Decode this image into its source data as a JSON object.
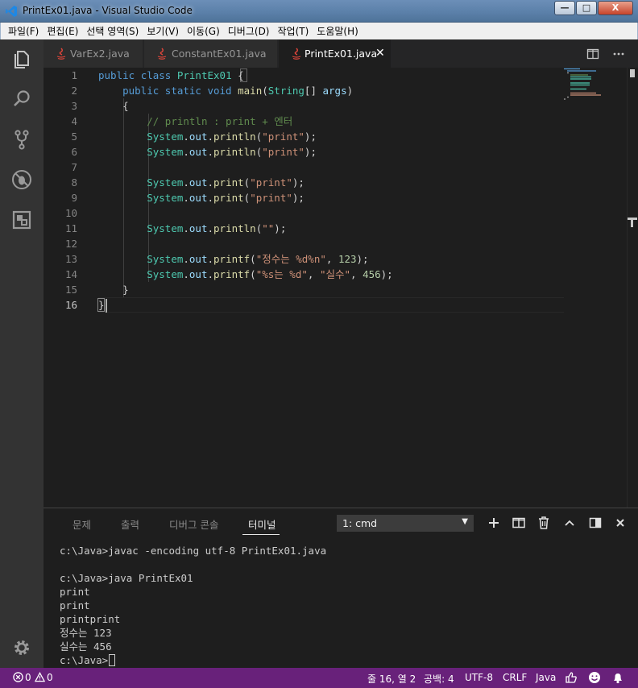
{
  "window": {
    "title": "PrintEx01.java - Visual Studio Code",
    "controls": {
      "minimize": "—",
      "maximize": "□",
      "close": "X"
    }
  },
  "menu": [
    "파일(F)",
    "편집(E)",
    "선택 영역(S)",
    "보기(V)",
    "이동(G)",
    "디버그(D)",
    "작업(T)",
    "도움말(H)"
  ],
  "activity_bar": [
    "explorer-icon",
    "search-icon",
    "source-control-icon",
    "debug-icon",
    "extensions-icon",
    "settings-gear-icon"
  ],
  "tabs": [
    {
      "label": "VarEx2.java",
      "active": false
    },
    {
      "label": "ConstantEx01.java",
      "active": false
    },
    {
      "label": "PrintEx01.java",
      "active": true,
      "close": "✕"
    }
  ],
  "editor": {
    "line_numbers": [
      "1",
      "2",
      "3",
      "4",
      "5",
      "6",
      "7",
      "8",
      "9",
      "10",
      "11",
      "12",
      "13",
      "14",
      "15",
      "16"
    ],
    "current_line": "16",
    "lines": [
      [
        [
          "kw",
          "public"
        ],
        [
          "pl",
          " "
        ],
        [
          "kw",
          "class"
        ],
        [
          "pl",
          " "
        ],
        [
          "ty",
          "PrintEx01"
        ],
        [
          "pl",
          " {"
        ]
      ],
      [
        [
          "pl",
          "    "
        ],
        [
          "kw",
          "public"
        ],
        [
          "pl",
          " "
        ],
        [
          "kw",
          "static"
        ],
        [
          "pl",
          " "
        ],
        [
          "kw",
          "void"
        ],
        [
          "pl",
          " "
        ],
        [
          "fn",
          "main"
        ],
        [
          "pl",
          "("
        ],
        [
          "ty",
          "String"
        ],
        [
          "pl",
          "[] "
        ],
        [
          "id",
          "args"
        ],
        [
          "pl",
          ")"
        ]
      ],
      [
        [
          "pl",
          "    {"
        ]
      ],
      [
        [
          "pl",
          "        "
        ],
        [
          "cm",
          "// println : print + 엔터"
        ]
      ],
      [
        [
          "pl",
          "        "
        ],
        [
          "ty",
          "System"
        ],
        [
          "pl",
          "."
        ],
        [
          "id",
          "out"
        ],
        [
          "pl",
          "."
        ],
        [
          "fn",
          "println"
        ],
        [
          "pl",
          "("
        ],
        [
          "st",
          "\"print\""
        ],
        [
          "pl",
          ");"
        ]
      ],
      [
        [
          "pl",
          "        "
        ],
        [
          "ty",
          "System"
        ],
        [
          "pl",
          "."
        ],
        [
          "id",
          "out"
        ],
        [
          "pl",
          "."
        ],
        [
          "fn",
          "println"
        ],
        [
          "pl",
          "("
        ],
        [
          "st",
          "\"print\""
        ],
        [
          "pl",
          ");"
        ]
      ],
      [],
      [
        [
          "pl",
          "        "
        ],
        [
          "ty",
          "System"
        ],
        [
          "pl",
          "."
        ],
        [
          "id",
          "out"
        ],
        [
          "pl",
          "."
        ],
        [
          "fn",
          "print"
        ],
        [
          "pl",
          "("
        ],
        [
          "st",
          "\"print\""
        ],
        [
          "pl",
          ");"
        ]
      ],
      [
        [
          "pl",
          "        "
        ],
        [
          "ty",
          "System"
        ],
        [
          "pl",
          "."
        ],
        [
          "id",
          "out"
        ],
        [
          "pl",
          "."
        ],
        [
          "fn",
          "print"
        ],
        [
          "pl",
          "("
        ],
        [
          "st",
          "\"print\""
        ],
        [
          "pl",
          ");"
        ]
      ],
      [],
      [
        [
          "pl",
          "        "
        ],
        [
          "ty",
          "System"
        ],
        [
          "pl",
          "."
        ],
        [
          "id",
          "out"
        ],
        [
          "pl",
          "."
        ],
        [
          "fn",
          "println"
        ],
        [
          "pl",
          "("
        ],
        [
          "st",
          "\"\""
        ],
        [
          "pl",
          ");"
        ]
      ],
      [],
      [
        [
          "pl",
          "        "
        ],
        [
          "ty",
          "System"
        ],
        [
          "pl",
          "."
        ],
        [
          "id",
          "out"
        ],
        [
          "pl",
          "."
        ],
        [
          "fn",
          "printf"
        ],
        [
          "pl",
          "("
        ],
        [
          "st",
          "\"정수는 %d%n\""
        ],
        [
          "pl",
          ", "
        ],
        [
          "nu",
          "123"
        ],
        [
          "pl",
          ");"
        ]
      ],
      [
        [
          "pl",
          "        "
        ],
        [
          "ty",
          "System"
        ],
        [
          "pl",
          "."
        ],
        [
          "id",
          "out"
        ],
        [
          "pl",
          "."
        ],
        [
          "fn",
          "printf"
        ],
        [
          "pl",
          "("
        ],
        [
          "st",
          "\"%s는 %d\""
        ],
        [
          "pl",
          ", "
        ],
        [
          "st",
          "\"실수\""
        ],
        [
          "pl",
          ", "
        ],
        [
          "nu",
          "456"
        ],
        [
          "pl",
          ");"
        ]
      ],
      [
        [
          "pl",
          "    }"
        ]
      ],
      [
        [
          "pl",
          "}"
        ]
      ]
    ]
  },
  "panel": {
    "tabs": [
      {
        "label": "문제",
        "active": false
      },
      {
        "label": "출력",
        "active": false
      },
      {
        "label": "디버그 콘솔",
        "active": false
      },
      {
        "label": "터미널",
        "active": true
      }
    ],
    "terminal_select": "1: cmd",
    "actions": [
      "plus-icon",
      "split-terminal-icon",
      "trash-icon",
      "chevron-up-icon",
      "toggle-panel-icon",
      "close-icon"
    ],
    "terminal_lines": [
      "c:\\Java>javac -encoding utf-8 PrintEx01.java",
      "",
      "c:\\Java>java PrintEx01",
      "print",
      "print",
      "printprint",
      "정수는 123",
      "실수는 456",
      "c:\\Java>"
    ]
  },
  "status": {
    "errors": "0",
    "warnings": "0",
    "position": "줄 16, 열 2",
    "spaces": "공백: 4",
    "encoding": "UTF-8",
    "eol": "CRLF",
    "language": "Java"
  },
  "colors": {
    "status_bar": "#68217a",
    "activity_bar": "#333333",
    "editor_bg": "#1e1e1e",
    "keyword": "#569cd6",
    "type": "#4ec9b0",
    "string": "#ce9178",
    "comment": "#608b4e"
  }
}
